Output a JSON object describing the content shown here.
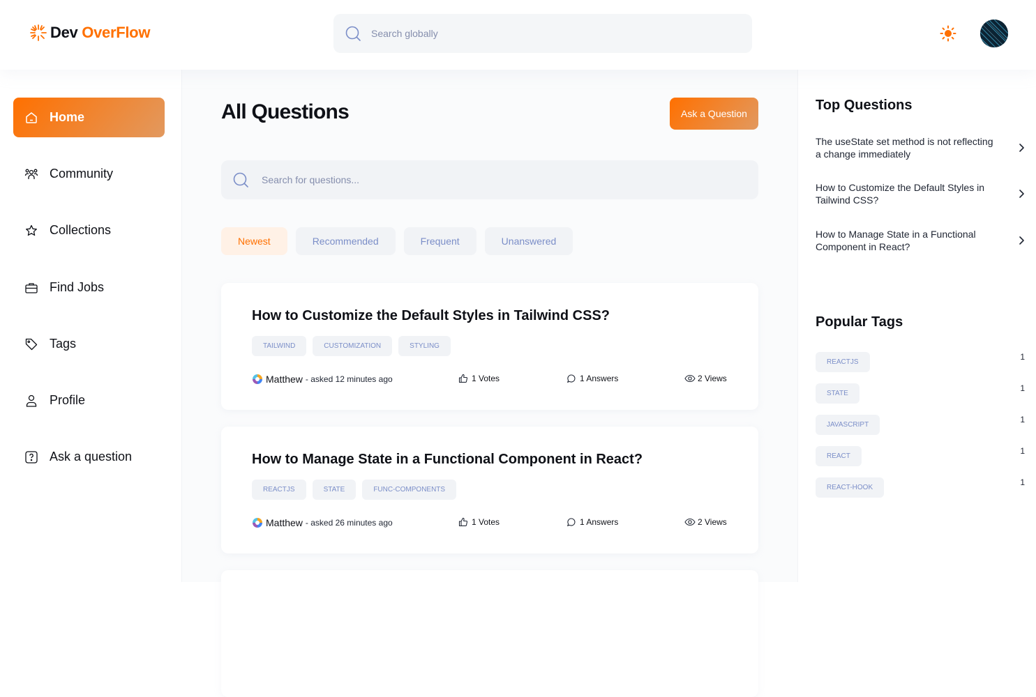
{
  "brand": {
    "name_part1": "Dev",
    "name_part2": "OverFlow",
    "accent": "#ff7000"
  },
  "header": {
    "global_search_placeholder": "Search globally",
    "theme_icon": "sun-icon",
    "avatar_alt": "user-avatar"
  },
  "sidebar": {
    "items": [
      {
        "label": "Home",
        "icon": "home-icon",
        "active": true
      },
      {
        "label": "Community",
        "icon": "community-icon",
        "active": false
      },
      {
        "label": "Collections",
        "icon": "star-icon",
        "active": false
      },
      {
        "label": "Find Jobs",
        "icon": "briefcase-icon",
        "active": false
      },
      {
        "label": "Tags",
        "icon": "tag-icon",
        "active": false
      },
      {
        "label": "Profile",
        "icon": "user-icon",
        "active": false
      },
      {
        "label": "Ask a question",
        "icon": "question-icon",
        "active": false
      }
    ]
  },
  "main": {
    "title": "All Questions",
    "ask_button": "Ask a Question",
    "search_placeholder": "Search for questions...",
    "filters": [
      "Newest",
      "Recommended",
      "Frequent",
      "Unanswered"
    ],
    "active_filter": "Newest",
    "questions": [
      {
        "title": "How to Customize the Default Styles in Tailwind CSS?",
        "tags": [
          "TAILWIND",
          "CUSTOMIZATION",
          "STYLING"
        ],
        "author": "Matthew",
        "asked": "- asked 12 minutes ago",
        "votes": "1 Votes",
        "answers": "1 Answers",
        "views": "2 Views"
      },
      {
        "title": "How to Manage State in a Functional Component in React?",
        "tags": [
          "REACTJS",
          "STATE",
          "FUNC-COMPONENTS"
        ],
        "author": "Matthew",
        "asked": "- asked 26 minutes ago",
        "votes": "1 Votes",
        "answers": "1 Answers",
        "views": "2 Views"
      }
    ]
  },
  "rightbar": {
    "top_questions_title": "Top Questions",
    "top_questions": [
      "The useState set method is not reflecting a change immediately",
      "How to Customize the Default Styles in Tailwind CSS?",
      "How to Manage State in a Functional Component in React?"
    ],
    "popular_tags_title": "Popular Tags",
    "popular_tags": [
      {
        "name": "REACTJS",
        "count": "1"
      },
      {
        "name": "STATE",
        "count": "1"
      },
      {
        "name": "JAVASCRIPT",
        "count": "1"
      },
      {
        "name": "REACT",
        "count": "1"
      },
      {
        "name": "REACT-HOOK",
        "count": "1"
      }
    ]
  }
}
